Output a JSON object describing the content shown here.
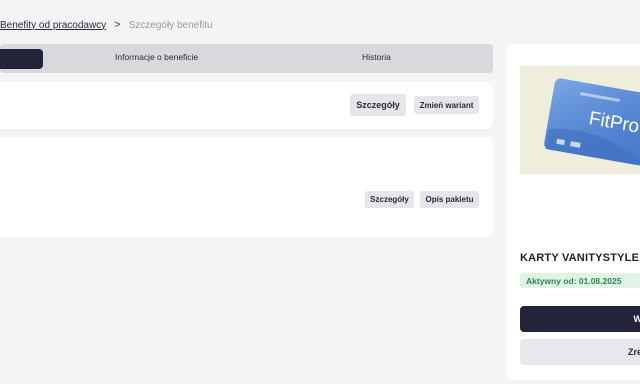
{
  "breadcrumb": {
    "link": "Benefity od pracodawcy",
    "separator": ">",
    "current": "Szczegóły benefitu"
  },
  "tabs": [
    {
      "label": ""
    },
    {
      "label": "Informacje o beneficie"
    },
    {
      "label": "Historia"
    }
  ],
  "card1": {
    "details_button": "Szczegóły",
    "change_variant_button": "Zmień wariant"
  },
  "card2": {
    "details_button": "Szczegóły",
    "package_description_button": "Opis pakietu"
  },
  "side": {
    "card_brand_text": "FitPro",
    "title": "KARTY VANITYSTYLE",
    "active_badge": "Aktywny od: 01.08.2025",
    "primary_button": "W",
    "secondary_button": "Zre"
  },
  "colors": {
    "dark": "#23233a",
    "badge_green": "#2c8a4f",
    "badge_bg": "#dff3e6",
    "card_blue": "#4f85d6"
  }
}
